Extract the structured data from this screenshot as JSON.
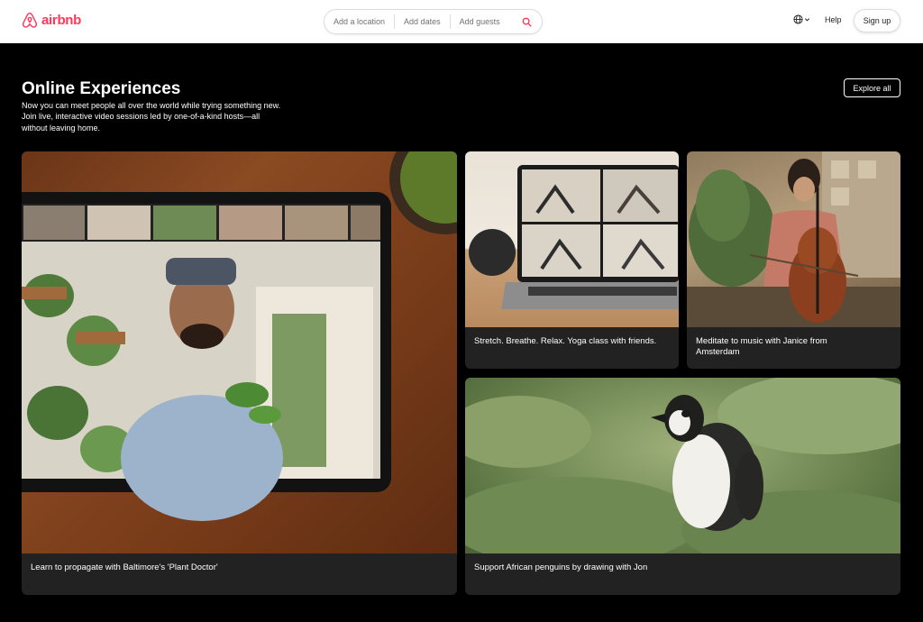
{
  "header": {
    "logo_text": "airbnb",
    "brand_color": "#ff385c",
    "search": {
      "location": "Add a location",
      "dates": "Add dates",
      "guests": "Add guests",
      "search_icon": "search-icon"
    },
    "language_icon": "globe-icon",
    "help_label": "Help",
    "signup_label": "Sign up"
  },
  "intro": {
    "title": "Online Experiences",
    "description": "Now you can meet people all over the world while trying something new. Join live, interactive video sessions led by one-of-a-kind hosts—all without leaving home.",
    "explore_label": "Explore all"
  },
  "cards": {
    "plant": {
      "caption": "Learn to propagate with Baltimore's 'Plant Doctor'"
    },
    "yoga": {
      "caption": "Stretch. Breathe. Relax. Yoga class with friends."
    },
    "cello": {
      "caption": "Meditate to music with Janice from Amsterdam"
    },
    "penguin": {
      "caption": "Support African penguins by drawing with Jon"
    }
  }
}
